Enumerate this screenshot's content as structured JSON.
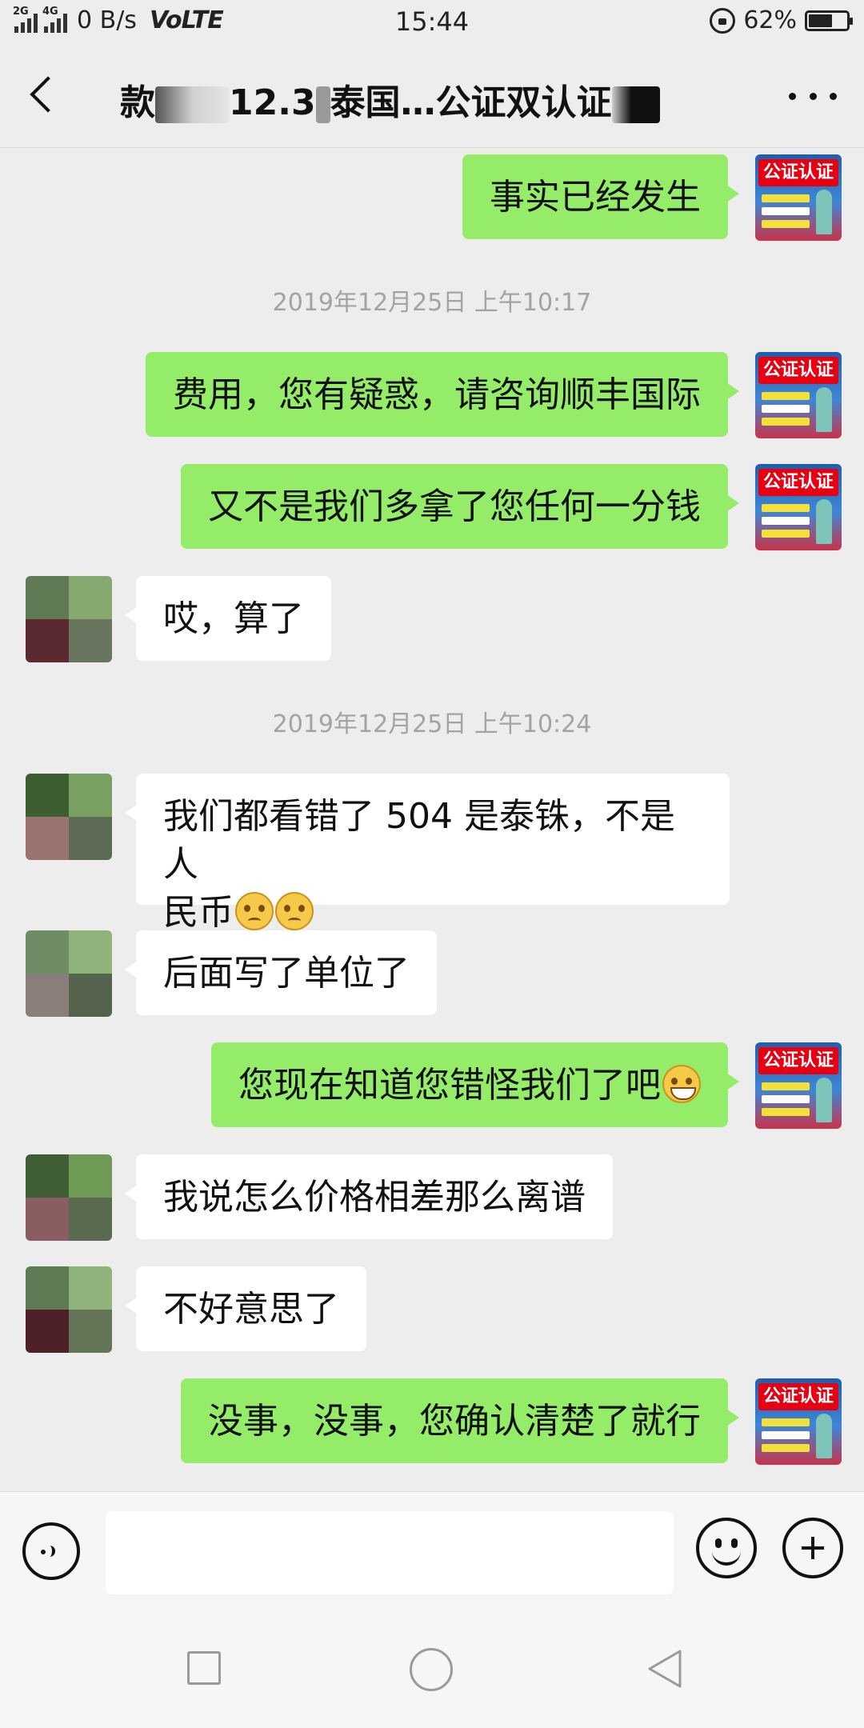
{
  "status_bar": {
    "network_left": "2G",
    "network_right": "4G",
    "speed": "0 B/s",
    "volte": "VoLTE",
    "time": "15:44",
    "battery": "62%",
    "battery_level": 0.62
  },
  "header": {
    "title_part1": "款",
    "title_part2": "12.3",
    "title_part3": "泰国…公证双认证",
    "back_icon": "back-arrow-icon",
    "more_icon": "more-dots-icon"
  },
  "messages": {
    "m1": "事实已经发生",
    "ts1": "2019年12月25日 上午10:17",
    "m2": "费用，您有疑惑，请咨询顺丰国际",
    "m3": "又不是我们多拿了您任何一分钱",
    "m4": "哎，算了",
    "ts2": "2019年12月25日 上午10:24",
    "m5_line1": "我们都看错了 504 是泰铢，不是人",
    "m5_line2": "民币",
    "m6": "后面写了单位了",
    "m7": "您现在知道您错怪我们了吧",
    "m8": "我说怎么价格相差那么离谱",
    "m9": "不好意思了",
    "m10": "没事，没事，您确认清楚了就行"
  },
  "avatar_me": {
    "badge": "公证认证"
  },
  "input_bar": {
    "value": "",
    "voice_icon": "voice-icon",
    "emoji_icon": "emoji-icon",
    "plus_icon": "plus-icon"
  },
  "colors": {
    "background": "#ededed",
    "outgoing_bubble": "#95ec69",
    "incoming_bubble": "#ffffff",
    "timestamp": "#a3a3a3"
  }
}
